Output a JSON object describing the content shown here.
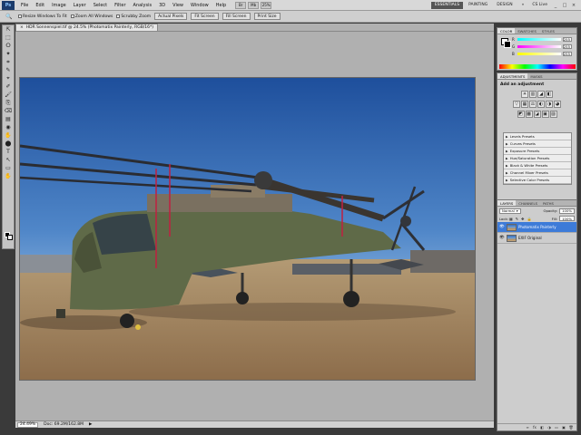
{
  "app": {
    "logo": "Ps"
  },
  "menu": {
    "items": [
      "File",
      "Edit",
      "Image",
      "Layer",
      "Select",
      "Filter",
      "Analysis",
      "3D",
      "View",
      "Window",
      "Help"
    ]
  },
  "menu_tools": [
    "Br",
    "Mb"
  ],
  "zoom_percent": "25%",
  "workspace": {
    "buttons": [
      "ESSENTIALS",
      "PAINTING",
      "DESIGN",
      "»"
    ],
    "active_index": 0,
    "cs_live": "CS Live"
  },
  "window_controls": [
    "_",
    "□",
    "×"
  ],
  "options": {
    "checks": [
      "Resize Windows To Fit",
      "Zoom All Windows",
      "Scrubby Zoom"
    ],
    "buttons": [
      "Actual Pixels",
      "Fit Screen",
      "Fill Screen",
      "Print Size"
    ]
  },
  "document": {
    "tab_title": "HDR Sonnenspiel.tif @ 24.5% (Photomatix Painterly, RGB/16*)",
    "close_glyph": "×",
    "zoom": "24.49%",
    "doc_size": "Doc: 69.2M/162.8M",
    "arrow": "▶"
  },
  "tools": [
    "⇱",
    "⬚",
    "ⵔ",
    "✦",
    "⌗",
    "✎",
    "⌖",
    "✐",
    "🖌",
    "⎘",
    "⌫",
    "▤",
    "◉",
    "✋",
    "⬤",
    "T",
    "↖",
    "▭",
    "✋",
    "🔍"
  ],
  "color_panel": {
    "tabs": [
      "COLOR",
      "SWATCHES",
      "STYLES"
    ],
    "rows": [
      {
        "label": "R",
        "value": "255",
        "color": "#ff3030"
      },
      {
        "label": "G",
        "value": "255",
        "color": "#30c030"
      },
      {
        "label": "B",
        "value": "255",
        "color": "#3060ff"
      }
    ]
  },
  "adjustments_panel": {
    "tabs": [
      "ADJUSTMENTS",
      "MASKS"
    ],
    "title": "Add an adjustment",
    "icon_rows": [
      [
        "☀",
        "▥",
        "◢",
        "◧"
      ],
      [
        "▽",
        "▦",
        "⚖",
        "◐",
        "◑",
        "◕"
      ],
      [
        "◩",
        "▩",
        "◪",
        "▣",
        "▨"
      ]
    ],
    "presets": [
      "Levels Presets",
      "Curves Presets",
      "Exposure Presets",
      "Hue/Saturation Presets",
      "Black & White Presets",
      "Channel Mixer Presets",
      "Selective Color Presets"
    ],
    "footer_icons": [
      "◧",
      "↻"
    ]
  },
  "layers_panel": {
    "tabs": [
      "LAYERS",
      "CHANNELS",
      "PATHS"
    ],
    "blend_mode": "Normal",
    "opacity_label": "Opacity:",
    "opacity": "100%",
    "lock_label": "Lock:",
    "lock_icons": [
      "▦",
      "✎",
      "✥",
      "🔒"
    ],
    "fill_label": "Fill:",
    "fill": "100%",
    "layers": [
      {
        "name": "Photomatix Painterly",
        "selected": true,
        "eye": "👁"
      },
      {
        "name": "EXIF Original",
        "selected": false,
        "eye": "👁"
      }
    ],
    "footer_icons": [
      "∞",
      "fx",
      "◧",
      "◑",
      "▭",
      "▣",
      "🗑"
    ]
  }
}
